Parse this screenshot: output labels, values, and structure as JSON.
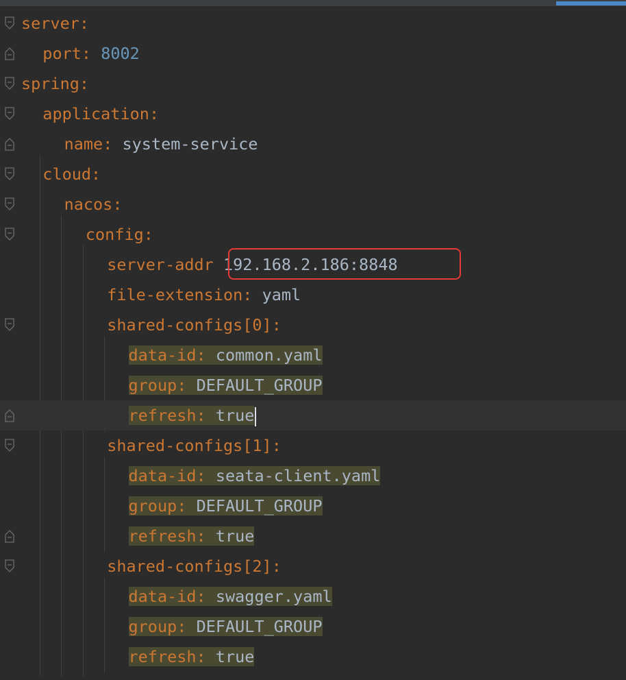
{
  "editor": {
    "lines": [
      {
        "key": "server",
        "colon": ":",
        "value": ""
      },
      {
        "key": "port",
        "colon": ":",
        "value": "8002"
      },
      {
        "key": "spring",
        "colon": ":",
        "value": ""
      },
      {
        "key": "application",
        "colon": ":",
        "value": ""
      },
      {
        "key": "name",
        "colon": ":",
        "value": "system-service"
      },
      {
        "key": "cloud",
        "colon": ":",
        "value": ""
      },
      {
        "key": "nacos",
        "colon": ":",
        "value": ""
      },
      {
        "key": "config",
        "colon": ":",
        "value": ""
      },
      {
        "key": "server-addr",
        "colon": "",
        "value": "192.168.2.186:8848"
      },
      {
        "key": "file-extension",
        "colon": ":",
        "value": "yaml"
      },
      {
        "key": "shared-configs[0]",
        "colon": ":",
        "value": ""
      },
      {
        "key": "data-id",
        "colon": ":",
        "value": "common.yaml"
      },
      {
        "key": "group",
        "colon": ":",
        "value": "DEFAULT_GROUP"
      },
      {
        "key": "refresh",
        "colon": ":",
        "value": "true"
      },
      {
        "key": "shared-configs[1]",
        "colon": ":",
        "value": ""
      },
      {
        "key": "data-id",
        "colon": ":",
        "value": "seata-client.yaml"
      },
      {
        "key": "group",
        "colon": ":",
        "value": "DEFAULT_GROUP"
      },
      {
        "key": "refresh",
        "colon": ":",
        "value": "true"
      },
      {
        "key": "shared-configs[2]",
        "colon": ":",
        "value": ""
      },
      {
        "key": "data-id",
        "colon": ":",
        "value": "swagger.yaml"
      },
      {
        "key": "group",
        "colon": ":",
        "value": "DEFAULT_GROUP"
      },
      {
        "key": "refresh",
        "colon": ":",
        "value": "true"
      }
    ]
  },
  "colors": {
    "background": "#2b2b2b",
    "key": "#cc7832",
    "number": "#6897bb",
    "text": "#a9b7c6",
    "highlight": "#4a4932",
    "annotation_box": "#e53935"
  },
  "icons": [
    "fold-marker-icon",
    "fold-end-icon"
  ]
}
